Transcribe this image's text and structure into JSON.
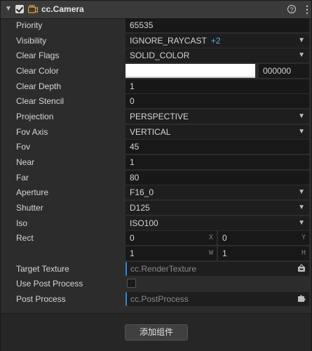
{
  "header": {
    "title": "cc.Camera"
  },
  "props": {
    "priority": {
      "label": "Priority",
      "value": "65535"
    },
    "visibility": {
      "label": "Visibility",
      "value": "IGNORE_RAYCAST",
      "extra": "+2"
    },
    "clear_flags": {
      "label": "Clear Flags",
      "value": "SOLID_COLOR"
    },
    "clear_color": {
      "label": "Clear Color",
      "hex": "000000",
      "swatch": "#ffffff"
    },
    "clear_depth": {
      "label": "Clear Depth",
      "value": "1"
    },
    "clear_stencil": {
      "label": "Clear Stencil",
      "value": "0"
    },
    "projection": {
      "label": "Projection",
      "value": "PERSPECTIVE"
    },
    "fov_axis": {
      "label": "Fov Axis",
      "value": "VERTICAL"
    },
    "fov": {
      "label": "Fov",
      "value": "45"
    },
    "near": {
      "label": "Near",
      "value": "1"
    },
    "far": {
      "label": "Far",
      "value": "80"
    },
    "aperture": {
      "label": "Aperture",
      "value": "F16_0"
    },
    "shutter": {
      "label": "Shutter",
      "value": "D125"
    },
    "iso": {
      "label": "Iso",
      "value": "ISO100"
    },
    "rect": {
      "label": "Rect",
      "x": "0",
      "y": "0",
      "w": "1",
      "h": "1",
      "x_axis": "X",
      "y_axis": "Y",
      "w_axis": "W",
      "h_axis": "H"
    },
    "target_texture": {
      "label": "Target Texture",
      "placeholder": "cc.RenderTexture"
    },
    "use_post_process": {
      "label": "Use Post Process",
      "checked": false
    },
    "post_process": {
      "label": "Post Process",
      "placeholder": "cc.PostProcess"
    }
  },
  "footer": {
    "add_component": "添加组件"
  }
}
